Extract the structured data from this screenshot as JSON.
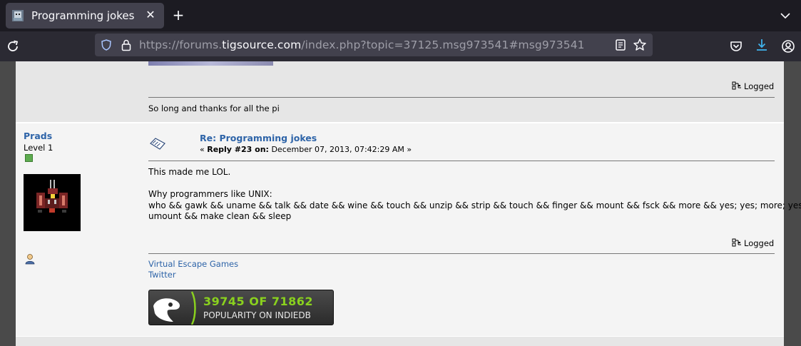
{
  "browser": {
    "tab_title": "Programming jokes",
    "tab_close": "✕",
    "new_tab": "+",
    "url_prefix": "https://forums.",
    "url_host": "tigsource.com",
    "url_path": "/index.php?topic=37125.msg973541#msg973541"
  },
  "post1": {
    "logged": "Logged",
    "signature": "So long and thanks for all the pi"
  },
  "post2": {
    "poster_name": "Prads",
    "poster_level": "Level 1",
    "subject": "Re: Programming jokes",
    "reply_prefix": "« ",
    "reply_label": "Reply #23 on:",
    "reply_date": " December 07, 2013, 07:42:29 AM »",
    "body_lines": [
      "This made me LOL.",
      "",
      "Why programmers like UNIX:",
      "who && gawk && uname && talk && date && wine && touch && unzip && strip && touch && finger && mount && fsck && more && yes; yes; more; yes;",
      "umount && make clean && sleep"
    ],
    "logged": "Logged",
    "signature_links": [
      "Virtual Escape Games",
      "Twitter"
    ],
    "indiedb_rank": "39745 OF 71862",
    "indiedb_caption": "POPULARITY ON INDIEDB"
  },
  "colors": {
    "link": "#2e64a8",
    "level_pip": "#5dab4f",
    "indiedb_green": "#8ad11e"
  }
}
